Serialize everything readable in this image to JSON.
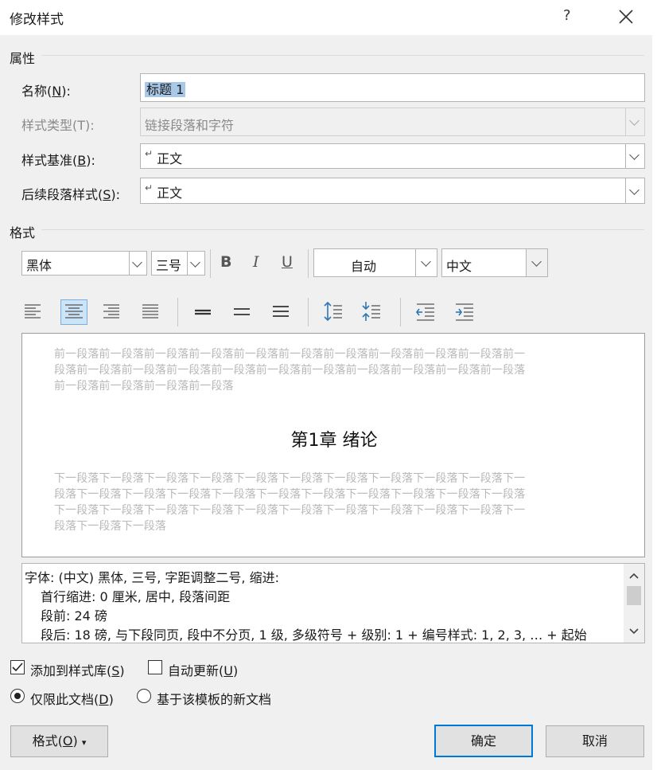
{
  "dialog": {
    "title": "修改样式",
    "help": "?",
    "close_label": "✕"
  },
  "properties": {
    "section_title": "属性",
    "name": {
      "label_pre": "名称(",
      "label_key": "N",
      "label_post": "):",
      "value": "标题 1"
    },
    "style_type": {
      "label": "样式类型(T):",
      "value": "链接段落和字符"
    },
    "based_on": {
      "label_pre": "样式基准(",
      "label_key": "B",
      "label_post": "):",
      "value": "正文",
      "glyph": "↵"
    },
    "following": {
      "label_pre": "后续段落样式(",
      "label_key": "S",
      "label_post": "):",
      "value": "正文",
      "glyph": "↵"
    }
  },
  "format": {
    "section_title": "格式",
    "font": "黑体",
    "size": "三号",
    "bold": "B",
    "italic": "I",
    "underline": "U",
    "color": "自动",
    "script": "中文"
  },
  "preview": {
    "prev_lines": [
      "前一段落前一段落前一段落前一段落前一段落前一段落前一段落前一段落前一段落前一段落前一",
      "段落前一段落前一段落前一段落前一段落前一段落前一段落前一段落前一段落前一段落前一段落",
      "前一段落前一段落前一段落前一段落"
    ],
    "heading": "第1章  绪论",
    "next_lines": [
      "下一段落下一段落下一段落下一段落下一段落下一段落下一段落下一段落下一段落下一段落下一",
      "段落下一段落下一段落下一段落下一段落下一段落下一段落下一段落下一段落下一段落下一段落",
      "下一段落下一段落下一段落下一段落下一段落下一段落下一段落下一段落下一段落下一段落下一",
      "段落下一段落下一段落"
    ]
  },
  "description": {
    "lines": [
      "字体: (中文) 黑体, 三号, 字距调整二号, 缩进:",
      "首行缩进:  0 厘米, 居中, 段落间距",
      "段前: 24 磅",
      "段后: 18 磅, 与下段同页, 段中不分页, 1 级, 多级符号 + 级别: 1 + 编号样式: 1, 2, 3, … + 起始"
    ]
  },
  "options": {
    "add_to_gallery": {
      "pre": "添加到样式库(",
      "key": "S",
      "post": ")",
      "checked": true
    },
    "auto_update": {
      "pre": "自动更新(",
      "key": "U",
      "post": ")",
      "checked": false
    },
    "this_doc_only": {
      "pre": "仅限此文档(",
      "key": "D",
      "post": ")",
      "selected": true
    },
    "new_docs": {
      "label": "基于该模板的新文档",
      "selected": false
    }
  },
  "buttons": {
    "format": {
      "pre": "格式(",
      "key": "O",
      "post": ")",
      "arrow": "▾"
    },
    "ok": "确定",
    "cancel": "取消"
  },
  "colors": {
    "accent": "#0078d7",
    "selected_bg": "#a8c8e8",
    "active_tool": "#cce4f7"
  }
}
